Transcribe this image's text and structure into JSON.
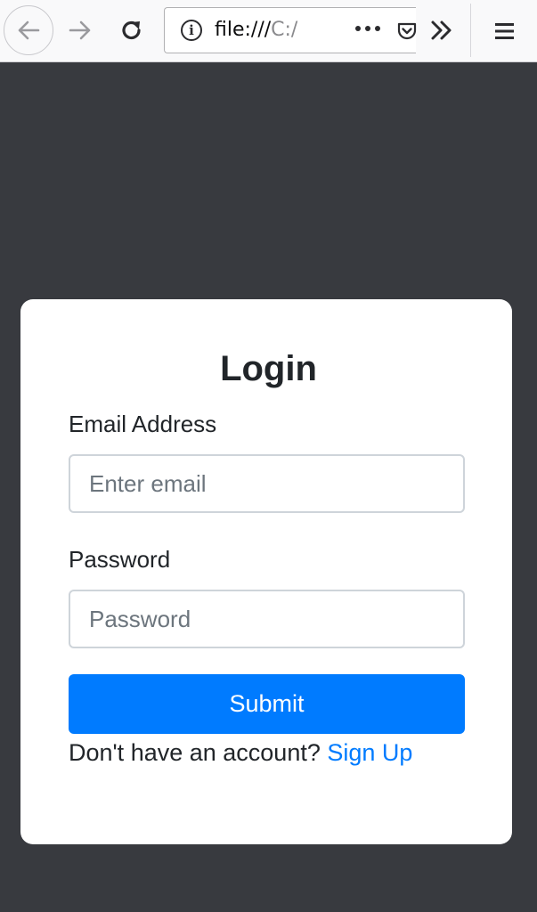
{
  "browser": {
    "url_prefix": "file:///",
    "url_suffix": "C:/",
    "icons": {
      "back": "arrow-left-icon",
      "forward": "arrow-right-icon",
      "reload": "reload-icon",
      "page_info": "info-icon",
      "page_actions": "more-dots-icon",
      "pocket": "pocket-icon",
      "overflow": "chevron-double-right-icon",
      "menu": "hamburger-menu-icon"
    }
  },
  "login": {
    "title": "Login",
    "email_label": "Email Address",
    "email_placeholder": "Enter email",
    "email_value": "",
    "password_label": "Password",
    "password_placeholder": "Password",
    "password_value": "",
    "submit_label": "Submit",
    "signup_prompt": "Don't have an account? ",
    "signup_link": "Sign Up"
  },
  "colors": {
    "page_background": "#383a3f",
    "card_background": "#ffffff",
    "primary": "#007bff",
    "text": "#212529",
    "input_border": "#ced4da"
  }
}
